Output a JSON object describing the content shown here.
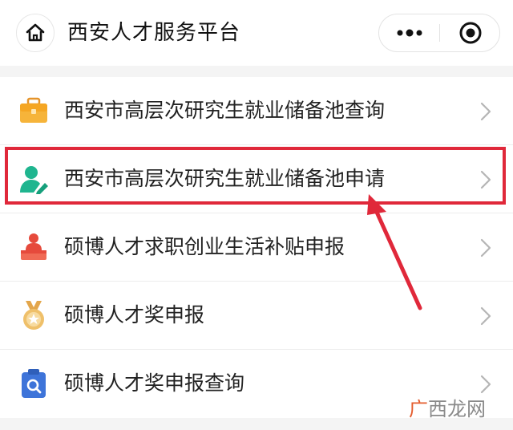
{
  "header": {
    "title": "西安人才服务平台",
    "home_icon": "home-icon",
    "more_icon": "more-dots-icon",
    "close_icon": "target-close-icon"
  },
  "menu": {
    "items": [
      {
        "label": "西安市高层次研究生就业储备池查询",
        "icon": "briefcase-icon",
        "color": "#f5a623"
      },
      {
        "label": "西安市高层次研究生就业储备池申请",
        "icon": "user-edit-icon",
        "color": "#1fb58f",
        "highlighted": true
      },
      {
        "label": "硕博人才求职创业生活补贴申报",
        "icon": "speaker-podium-icon",
        "color": "#e64a3c"
      },
      {
        "label": "硕博人才奖申报",
        "icon": "medal-icon",
        "color": "#e3a64b"
      },
      {
        "label": "硕博人才奖申报查询",
        "icon": "clipboard-search-icon",
        "color": "#3e74d9"
      }
    ]
  },
  "watermark": {
    "text_accent": "广",
    "text_rest": "西龙网"
  },
  "colors": {
    "highlight": "#e0283a",
    "arrow": "#e0283a"
  }
}
